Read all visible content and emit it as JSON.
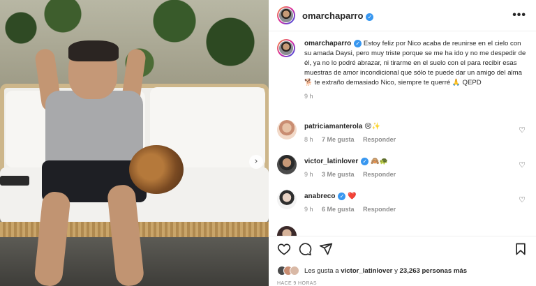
{
  "post": {
    "username": "omarchaparro",
    "verified_symbol": "✓",
    "more_label": "•••",
    "carousel_next": "›"
  },
  "caption": {
    "username": "omarchaparro",
    "text": "Estoy feliz por Nico acaba de reunirse en el cielo con su amada Daysi, pero muy triste porque se me ha ido y no me despedir de él, ya no lo podré abrazar, ni tirarme en el suelo con el para recibir esas muestras de amor incondicional que sólo te puede dar un amigo del alma 🐕 te extraño demasiado Nico, siempre te querré 🙏 QEPD",
    "time": "9 h"
  },
  "comments": [
    {
      "username": "patriciamanterola",
      "text": "😢✨",
      "time": "8 h",
      "likes": "7 Me gusta",
      "reply": "Responder",
      "heart": "♡"
    },
    {
      "username": "victor_latinlover",
      "verified": true,
      "text": "🙈🐢",
      "time": "9 h",
      "likes": "3 Me gusta",
      "reply": "Responder",
      "heart": "♡"
    },
    {
      "username": "anabreco",
      "verified": true,
      "text": "❤️",
      "time": "9 h",
      "likes": "6 Me gusta",
      "reply": "Responder",
      "heart": "♡"
    }
  ],
  "actions": {
    "like_icon": "heart-outline-icon",
    "comment_icon": "comment-bubble-icon",
    "share_icon": "paper-plane-icon",
    "save_icon": "bookmark-icon"
  },
  "likes_summary": {
    "prefix": "Les gusta a ",
    "user": "victor_latinlover",
    "middle": " y ",
    "count": "23,263 personas más"
  },
  "post_date": "HACE 9 HORAS",
  "colors": {
    "verified": "#3897f0",
    "heart_red": "#ed4956",
    "muted_text": "#8e8e8e"
  }
}
